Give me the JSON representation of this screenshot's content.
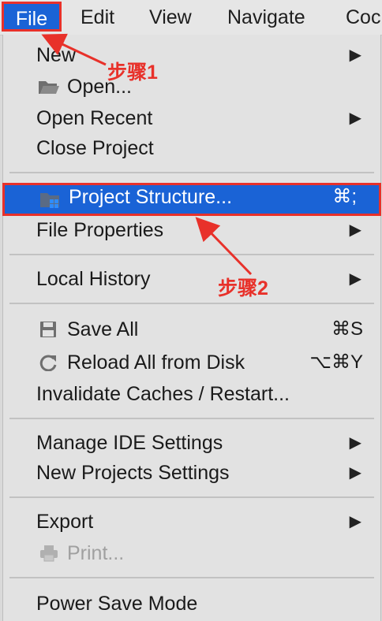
{
  "menubar": {
    "items": [
      "File",
      "Edit",
      "View",
      "Navigate",
      "Coc"
    ]
  },
  "dropdown": {
    "new": {
      "label": "New",
      "submenu": "▶"
    },
    "open": {
      "label": "Open..."
    },
    "open_recent": {
      "label": "Open Recent",
      "submenu": "▶"
    },
    "close_project": {
      "label": "Close Project"
    },
    "project_structure": {
      "label": "Project Structure...",
      "shortcut": "⌘;"
    },
    "file_properties": {
      "label": "File Properties",
      "submenu": "▶"
    },
    "local_history": {
      "label": "Local History",
      "submenu": "▶"
    },
    "save_all": {
      "label": "Save All",
      "shortcut": "⌘S"
    },
    "reload": {
      "label": "Reload All from Disk",
      "shortcut": "⌥⌘Y"
    },
    "invalidate": {
      "label": "Invalidate Caches / Restart..."
    },
    "manage_ide": {
      "label": "Manage IDE Settings",
      "submenu": "▶"
    },
    "new_projects": {
      "label": "New Projects Settings",
      "submenu": "▶"
    },
    "export": {
      "label": "Export",
      "submenu": "▶"
    },
    "print": {
      "label": "Print..."
    },
    "power_save": {
      "label": "Power Save Mode"
    }
  },
  "annotations": {
    "step1": "步骤1",
    "step2": "步骤2"
  },
  "colors": {
    "selection": "#1a63d6",
    "annotation": "#e8312a",
    "menu_bg": "#e2e2e2"
  }
}
